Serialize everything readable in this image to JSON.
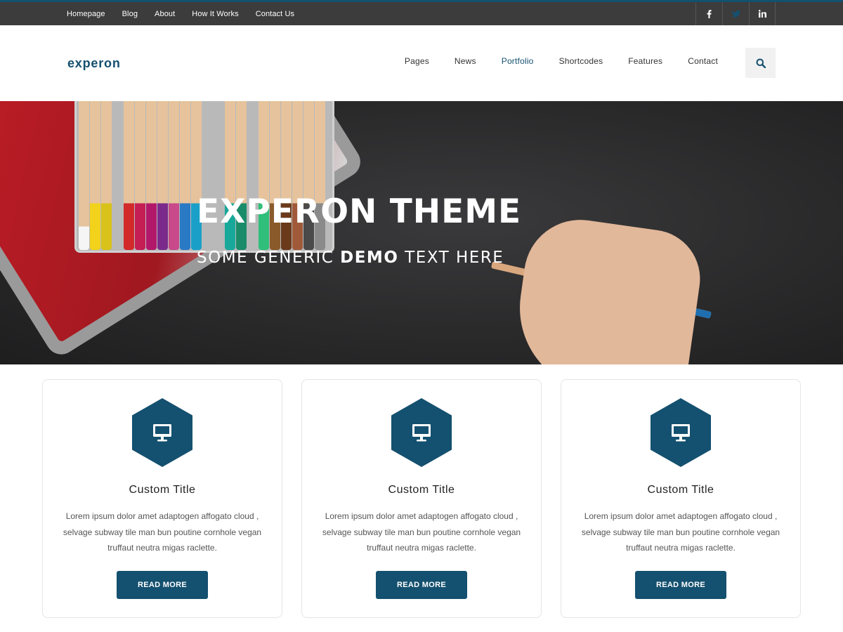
{
  "topbar": {
    "links": [
      "Homepage",
      "Blog",
      "About",
      "How It Works",
      "Contact Us"
    ],
    "social": [
      {
        "icon": "facebook-icon",
        "glyph": "f"
      },
      {
        "icon": "twitter-icon",
        "glyph": "t"
      },
      {
        "icon": "linkedin-icon",
        "glyph": "in"
      }
    ]
  },
  "header": {
    "logo": "experon",
    "nav": [
      "Pages",
      "News",
      "Portfolio",
      "Shortcodes",
      "Features",
      "Contact"
    ],
    "active_nav": "Portfolio",
    "search_icon": "search-icon"
  },
  "hero": {
    "title": "EXPERON THEME",
    "subtitle_pre": "SOME GENERIC ",
    "subtitle_bold": "DEMO",
    "subtitle_post": " TEXT HERE"
  },
  "cards": [
    {
      "icon": "monitor-icon",
      "title": "Custom Title",
      "text": "Lorem ipsum dolor amet adaptogen affogato cloud , selvage subway tile man bun poutine cornhole vegan truffaut neutra migas raclette.",
      "button": "READ MORE"
    },
    {
      "icon": "monitor-icon",
      "title": "Custom Title",
      "text": "Lorem ipsum dolor amet adaptogen affogato cloud , selvage subway tile man bun poutine cornhole vegan truffaut neutra migas raclette.",
      "button": "READ MORE"
    },
    {
      "icon": "monitor-icon",
      "title": "Custom Title",
      "text": "Lorem ipsum dolor amet adaptogen affogato cloud , selvage subway tile man bun poutine cornhole vegan truffaut neutra migas raclette.",
      "button": "READ MORE"
    }
  ],
  "colors": {
    "accent": "#14506f",
    "topbar_bg": "#3c3c3c",
    "hero_bg": "#2a2a2b"
  }
}
